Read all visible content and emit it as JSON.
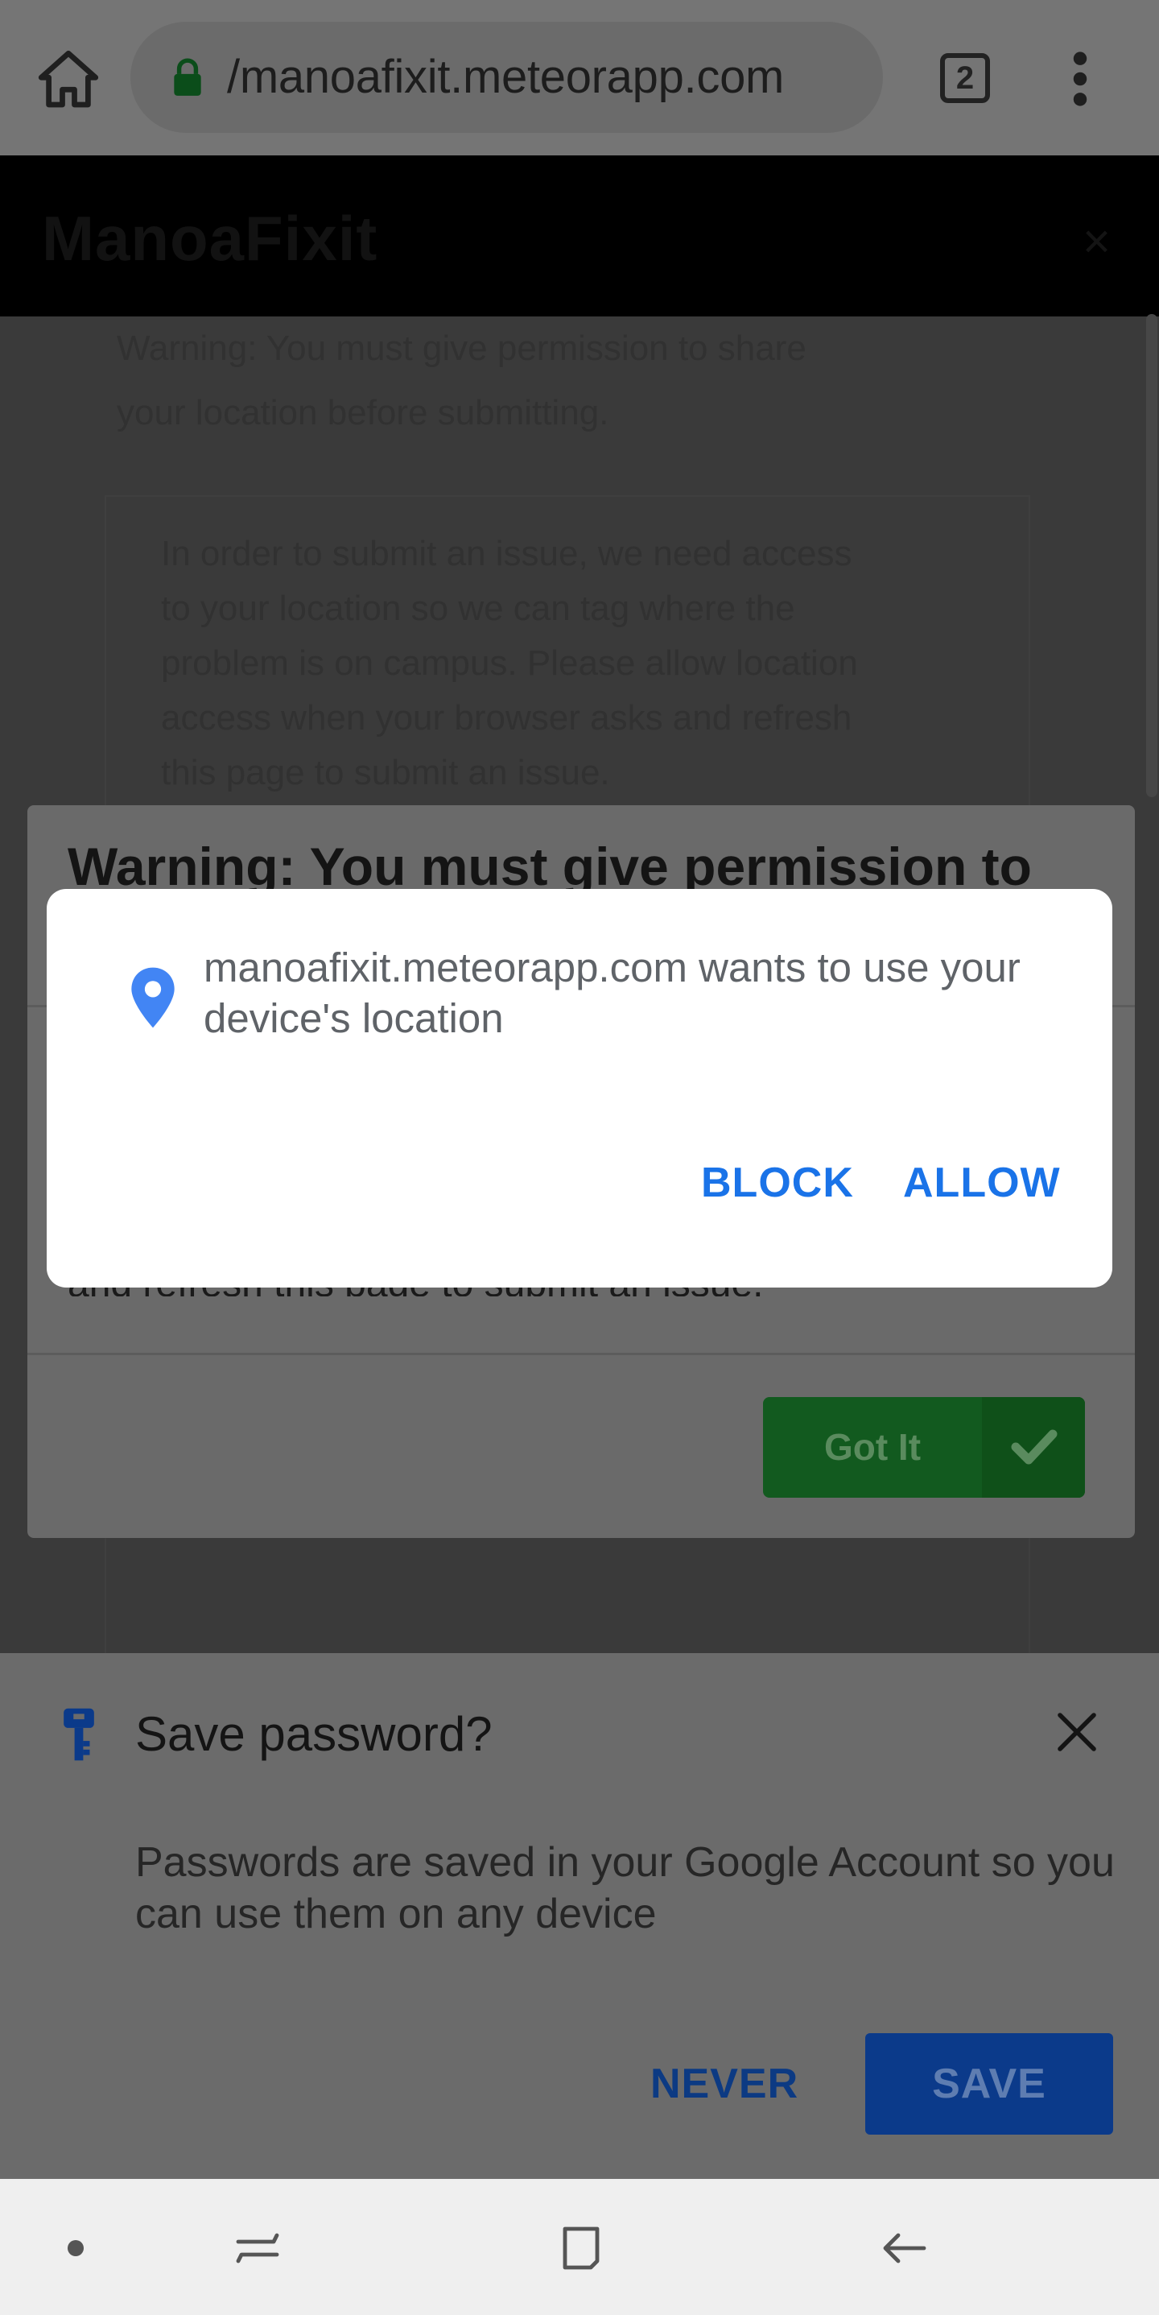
{
  "browser": {
    "url": "/manoafixit.meteorapp.com",
    "tab_count": "2"
  },
  "site": {
    "title": "ManoaFixit",
    "close_glyph": "×",
    "faded_lines": [
      "Warning: You must give permission to share",
      "your location before submitting."
    ],
    "faded_box_lines": [
      "In order to submit an issue, we need access",
      "to your location so we can tag where the",
      "problem is on campus. Please allow location",
      "access when your browser asks and refresh",
      "this page to submit an issue."
    ]
  },
  "warning_modal": {
    "title": "Warning: You must give permission to",
    "body_partial": "and refresh this page to submit an issue.",
    "got_it_label": "Got It"
  },
  "permission_dialog": {
    "message": "manoafixit.meteorapp.com wants to use your device's location",
    "block_label": "BLOCK",
    "allow_label": "ALLOW",
    "accent_color": "#1a73e8"
  },
  "save_password": {
    "title": "Save password?",
    "description": "Passwords are saved in your Google Account so you can use them on any device",
    "never_label": "NEVER",
    "save_label": "SAVE"
  },
  "icons": {
    "home": "home-icon",
    "lock": "lock-icon",
    "tabs": "tab-switcher-icon",
    "menu": "more-vert-icon",
    "location": "location-pin-icon",
    "key": "key-icon",
    "close": "close-icon"
  }
}
